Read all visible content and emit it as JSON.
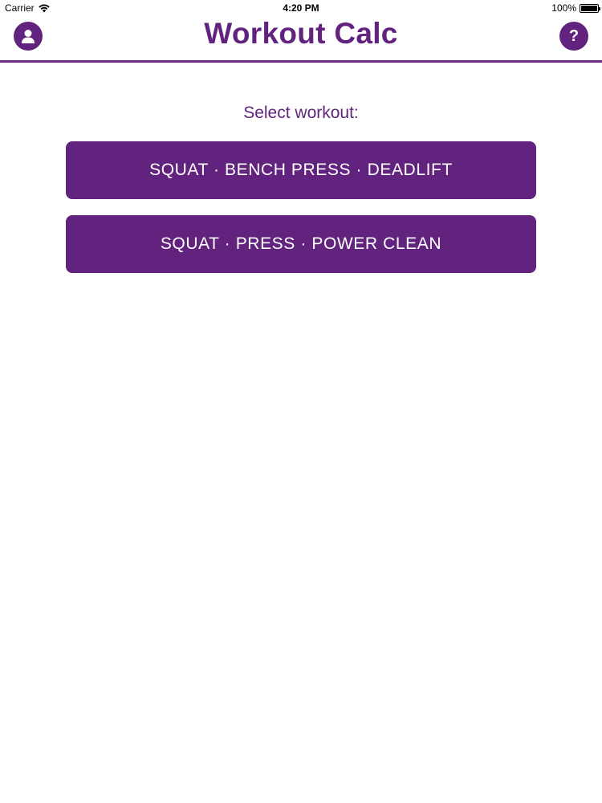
{
  "status_bar": {
    "carrier": "Carrier",
    "time": "4:20 PM",
    "battery": "100%"
  },
  "nav": {
    "title": "Workout Calc",
    "profile_icon": "person-icon",
    "help_icon": "question-icon",
    "help_glyph": "?"
  },
  "main": {
    "prompt": "Select workout:",
    "workouts": [
      {
        "label": "SQUAT · BENCH PRESS · DEADLIFT"
      },
      {
        "label": "SQUAT · PRESS · POWER CLEAN"
      }
    ]
  },
  "colors": {
    "accent": "#62237e",
    "background": "#ffffff",
    "button_text": "#ffffff"
  }
}
